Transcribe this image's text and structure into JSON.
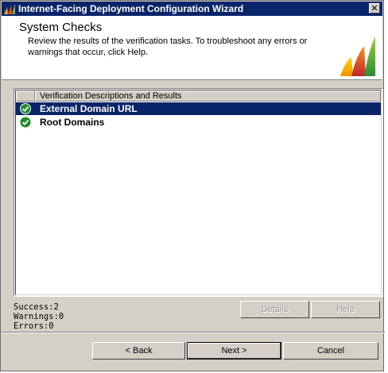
{
  "window": {
    "title": "Internet-Facing Deployment Configuration Wizard",
    "close_glyph": "✕",
    "title_icon": "dynamics-logo-icon"
  },
  "header": {
    "title": "System Checks",
    "description": "Review the results of the verification tasks. To troubleshoot any errors or warnings that occur, click Help.",
    "logo": "dynamics-logo-icon"
  },
  "list": {
    "column_header": "Verification Descriptions and Results",
    "rows": [
      {
        "label": "External Domain URL",
        "status": "success",
        "icon": "check-icon",
        "selected": true
      },
      {
        "label": "Root Domains",
        "status": "success",
        "icon": "check-icon",
        "selected": false
      }
    ]
  },
  "stats": {
    "success": "Success:2",
    "warnings": "Warnings:0",
    "errors": "Errors:0"
  },
  "buttons": {
    "details": "Details",
    "help": "Help",
    "back": "< Back",
    "next": "Next >",
    "cancel": "Cancel"
  },
  "colors": {
    "selection": "#0a246a",
    "success_green": "#1e8c2a",
    "dialog_face": "#d4d0c8"
  }
}
